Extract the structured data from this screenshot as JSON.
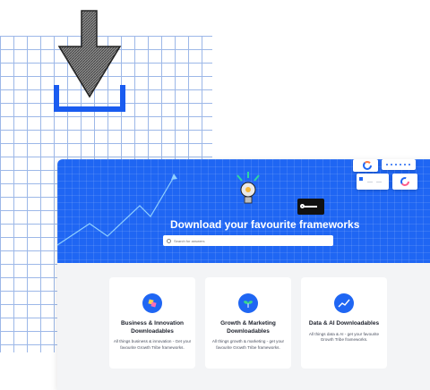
{
  "hero": {
    "title": "Download your favourite frameworks",
    "search_placeholder": "Search for answers"
  },
  "categories": [
    {
      "title_line1": "Business & Innovation",
      "title_line2": "Downloadables",
      "description": "All things business & innovation - Get your favourite Growth Tribe frameworks.",
      "icon": "puzzle-sparkle-icon"
    },
    {
      "title_line1": "Growth & Marketing",
      "title_line2": "Downloadables",
      "description": "All things growth & marketing - get your favourite Growth Tribe frameworks.",
      "icon": "sprout-icon"
    },
    {
      "title_line1": "Data & AI Downloadables",
      "title_line2": "",
      "description": "All things data & AI - get your favourite Growth Tribe frameworks.",
      "icon": "trend-line-icon"
    }
  ],
  "colors": {
    "accent": "#1f66f3",
    "grid": "#9db8e8",
    "background": "#f3f4f6"
  }
}
